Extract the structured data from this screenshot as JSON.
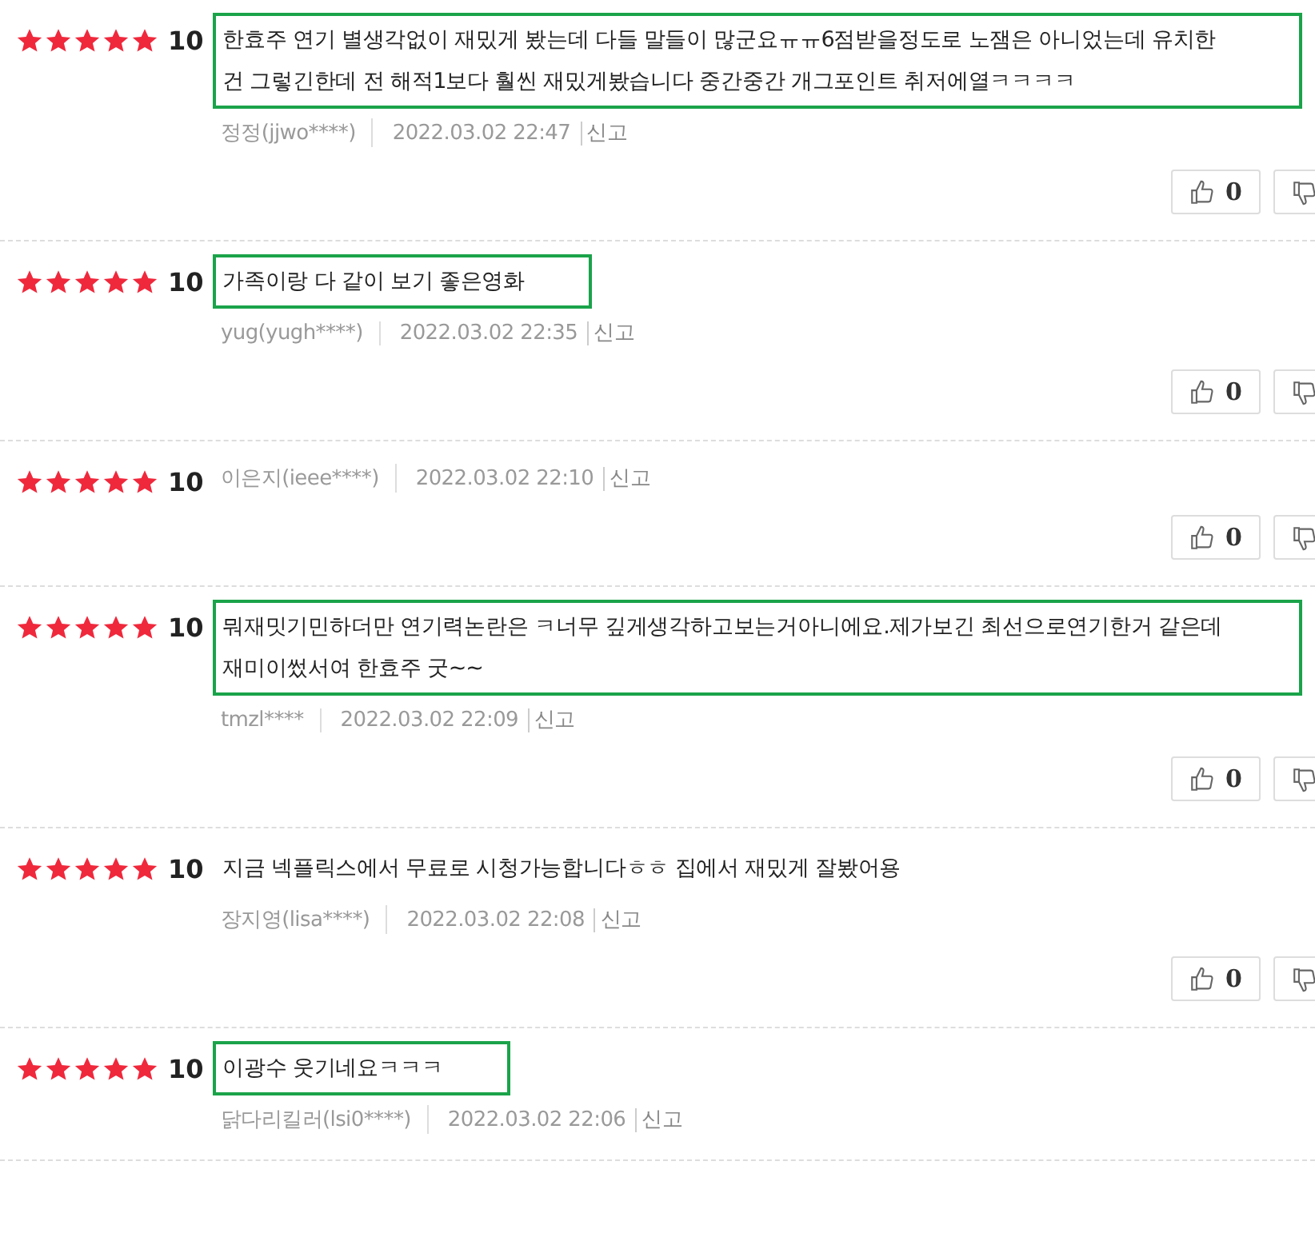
{
  "reviews": [
    {
      "stars": 5,
      "score": "10",
      "text": "한효주 연기 별생각없이 재밌게 봤는데 다들 말들이 많군요ㅠㅠ6점받을정도로 노잼은 아니었는데 유치한건 그렇긴한데 전 해적1보다 훨씬 재밌게봤습니다 중간중간 개그포인트 취저에열ㅋㅋㅋㅋ",
      "highlighted": true,
      "author": "정정(jjwo****)",
      "date": "2022.03.02 22:47",
      "report": "신고",
      "likes": "0"
    },
    {
      "stars": 5,
      "score": "10",
      "text": "가족이랑 다 같이 보기 좋은영화",
      "highlighted": true,
      "author": "yug(yugh****)",
      "date": "2022.03.02 22:35",
      "report": "신고",
      "likes": "0"
    },
    {
      "stars": 5,
      "score": "10",
      "author": "이은지(ieee****)",
      "highlighted": false,
      "date": "2022.03.02 22:10",
      "report": "신고",
      "likes": "0"
    },
    {
      "stars": 5,
      "score": "10",
      "text": "뭐재밋기민하더만 연기력논란은 ㅋ너무 깊게생각하고보는거아니에요.제가보긴 최선으로연기한거 같은데 재미이썼서여 한효주 굿~~",
      "highlighted": true,
      "author": "tmzl****",
      "date": "2022.03.02 22:09",
      "report": "신고",
      "likes": "0"
    },
    {
      "stars": 5,
      "score": "10",
      "text": "지금 넥플릭스에서 무료로 시청가능합니다ㅎㅎ 집에서 재밌게 잘봤어용",
      "highlighted": false,
      "author": "장지영(lisa****)",
      "date": "2022.03.02 22:08",
      "report": "신고",
      "likes": "0"
    },
    {
      "stars": 5,
      "score": "10",
      "text": "이광수 웃기네요ㅋㅋㅋ",
      "highlighted": true,
      "author": "닭다리킬러(lsi0****)",
      "date": "2022.03.02 22:06",
      "report": "신고"
    }
  ]
}
